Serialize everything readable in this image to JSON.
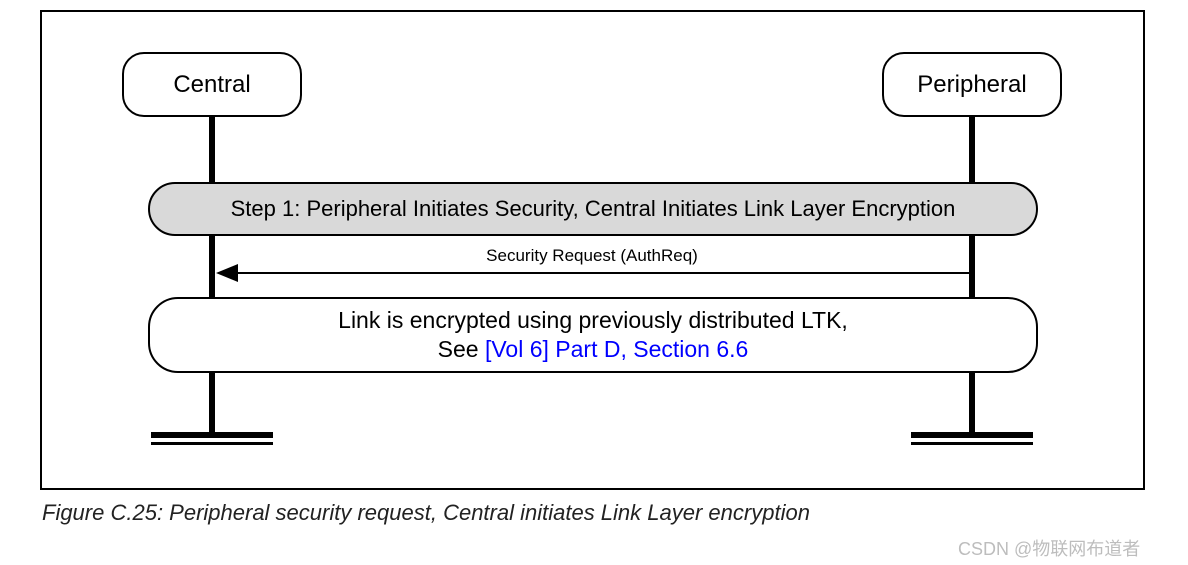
{
  "actors": {
    "left": "Central",
    "right": "Peripheral"
  },
  "step": {
    "label": "Step 1: Peripheral Initiates Security, Central Initiates Link Layer Encryption"
  },
  "message": {
    "label": "Security Request (AuthReq)"
  },
  "note": {
    "line1": "Link is encrypted using previously distributed LTK,",
    "line2_prefix": "See ",
    "line2_link": "[Vol 6] Part D, Section 6.6"
  },
  "caption": "Figure C.25:  Peripheral security request, Central initiates Link Layer encryption",
  "watermark": "CSDN @物联网布道者",
  "colors": {
    "link": "#0000ff",
    "pill_bg": "#d9d9d9"
  }
}
